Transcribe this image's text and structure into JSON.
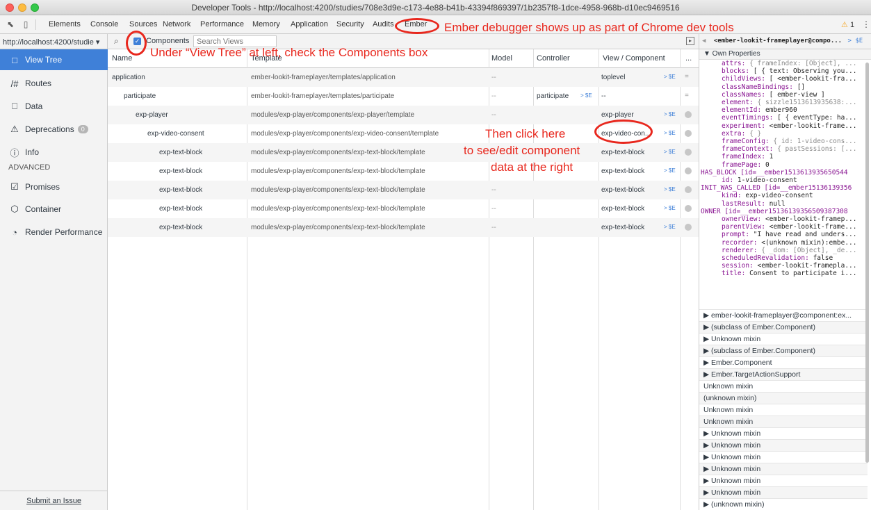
{
  "window": {
    "title": "Developer Tools - http://localhost:4200/studies/708e3d9e-c173-4e88-b41b-43394f869397/1b2357f8-1dce-4958-968b-d10ec9469516"
  },
  "devtools_tabs": [
    "Elements",
    "Console",
    "Sources",
    "Network",
    "Performance",
    "Memory",
    "Application",
    "Security",
    "Audits",
    "Ember"
  ],
  "warning_count": "1",
  "annotations": {
    "ember_tab": "Ember debugger shows up as part of Chrome dev tools",
    "view_tree": "Under “View Tree” at left, check the Components box",
    "click_here_line1": "Then click here",
    "click_here_line2": "to see/edit component",
    "click_here_line3": "data at the right",
    "color": "#e8271d"
  },
  "sidebar": {
    "url": "http://localhost:4200/studie ▾",
    "items": [
      {
        "label": "View Tree",
        "icon": "view-tree-icon",
        "active": true
      },
      {
        "label": "Routes",
        "icon": "routes-icon"
      },
      {
        "label": "Data",
        "icon": "data-icon"
      },
      {
        "label": "Deprecations",
        "icon": "warning-icon",
        "badge": "0"
      },
      {
        "label": "Info",
        "icon": "info-icon"
      }
    ],
    "section_label": "ADVANCED",
    "advanced_items": [
      {
        "label": "Promises",
        "icon": "promises-icon"
      },
      {
        "label": "Container",
        "icon": "container-icon"
      },
      {
        "label": "Render Performance",
        "icon": "render-performance-icon"
      }
    ],
    "submit_issue": "Submit an Issue"
  },
  "toolbar": {
    "components_label": "Components",
    "components_checked": true,
    "search_placeholder": "Search Views"
  },
  "table": {
    "headers": [
      "Name",
      "Template",
      "Model",
      "Controller",
      "View / Component",
      "..."
    ],
    "rows": [
      {
        "name": "application",
        "template": "ember-lookit-frameplayer/templates/application",
        "model": "--",
        "controller": "",
        "view": "toplevel",
        "indent": 0
      },
      {
        "name": "participate",
        "template": "ember-lookit-frameplayer/templates/participate",
        "model": "--",
        "controller": "participate",
        "view": "--",
        "indent": 1
      },
      {
        "name": "exp-player",
        "template": "modules/exp-player/components/exp-player/template",
        "model": "--",
        "controller": "",
        "view": "exp-player",
        "indent": 2
      },
      {
        "name": "exp-video-consent",
        "template": "modules/exp-player/components/exp-video-consent/template",
        "model": "",
        "controller": "",
        "view": "exp-video-con...",
        "indent": 3
      },
      {
        "name": "exp-text-block",
        "template": "modules/exp-player/components/exp-text-block/template",
        "model": "",
        "controller": "",
        "view": "exp-text-block",
        "indent": 4
      },
      {
        "name": "exp-text-block",
        "template": "modules/exp-player/components/exp-text-block/template",
        "model": "",
        "controller": "",
        "view": "exp-text-block",
        "indent": 4
      },
      {
        "name": "exp-text-block",
        "template": "modules/exp-player/components/exp-text-block/template",
        "model": "--",
        "controller": "",
        "view": "exp-text-block",
        "indent": 4
      },
      {
        "name": "exp-text-block",
        "template": "modules/exp-player/components/exp-text-block/template",
        "model": "--",
        "controller": "",
        "view": "exp-text-block",
        "indent": 4
      },
      {
        "name": "exp-text-block",
        "template": "modules/exp-player/components/exp-text-block/template",
        "model": "--",
        "controller": "",
        "view": "exp-text-block",
        "indent": 4
      }
    ],
    "dollar_label": "> $E"
  },
  "right_panel": {
    "header": "<ember-lookit-frameplayer@compo...",
    "header_suffix": "> $E",
    "own_properties": "▼ Own Properties",
    "props": [
      {
        "k": "attrs",
        "v": "{ frameIndex: [Object], ...",
        "gray": true
      },
      {
        "k": "blocks",
        "v": "[ { text: Observing you..."
      },
      {
        "k": "childViews",
        "v": "[ <ember-lookit-fra..."
      },
      {
        "k": "classNameBindings",
        "v": "[]"
      },
      {
        "k": "classNames",
        "v": "[ ember-view ]"
      },
      {
        "k": "element",
        "v": "{ sizzle1513613935638:...",
        "gray": true
      },
      {
        "k": "elementId",
        "v": "ember960"
      },
      {
        "k": "eventTimings",
        "v": "[ { eventType: ha..."
      },
      {
        "k": "experiment",
        "v": "<ember-lookit-frame..."
      },
      {
        "k": "extra",
        "v": "{ }",
        "gray": true
      },
      {
        "k": "frameConfig",
        "v": "{ id: 1-video-cons...",
        "gray": true
      },
      {
        "k": "frameContext",
        "v": "{ pastSessions: [...",
        "gray": true
      },
      {
        "k": "frameIndex",
        "v": "1"
      },
      {
        "k": "framePage",
        "v": "0"
      },
      {
        "k": "HAS_BLOCK [id=__ember1513613935650544",
        "v": "",
        "bare": true
      },
      {
        "k": "id",
        "v": "1-video-consent"
      },
      {
        "k": "INIT_WAS_CALLED [id=__ember15136139356",
        "v": "",
        "bare": true
      },
      {
        "k": "kind",
        "v": "exp-video-consent"
      },
      {
        "k": "lastResult",
        "v": "null"
      },
      {
        "k": "OWNER [id=__ember15136139356509387308",
        "v": "",
        "bare": true
      },
      {
        "k": "ownerView",
        "v": "<ember-lookit-framep..."
      },
      {
        "k": "parentView",
        "v": "<ember-lookit-frame..."
      },
      {
        "k": "prompt",
        "v": "\"I have read and unders..."
      },
      {
        "k": "recorder",
        "v": "<(unknown mixin):embe..."
      },
      {
        "k": "renderer",
        "v": "{ _dom: [Object], _de...",
        "gray": true
      },
      {
        "k": "scheduledRevalidation",
        "v": "false"
      },
      {
        "k": "session",
        "v": "<ember-lookit-framepla..."
      },
      {
        "k": "title",
        "v": "Consent to participate i..."
      }
    ],
    "mixins": [
      "▶ ember-lookit-frameplayer@component:ex...",
      "▶ (subclass of Ember.Component)",
      "▶ Unknown mixin",
      "▶ (subclass of Ember.Component)",
      "▶ Ember.Component",
      "▶ Ember.TargetActionSupport",
      "Unknown mixin",
      "(unknown mixin)",
      "Unknown mixin",
      "Unknown mixin",
      "▶ Unknown mixin",
      "▶ Unknown mixin",
      "▶ Unknown mixin",
      "▶ Unknown mixin",
      "▶ Unknown mixin",
      "▶ Unknown mixin",
      "▶ (unknown mixin)"
    ]
  }
}
